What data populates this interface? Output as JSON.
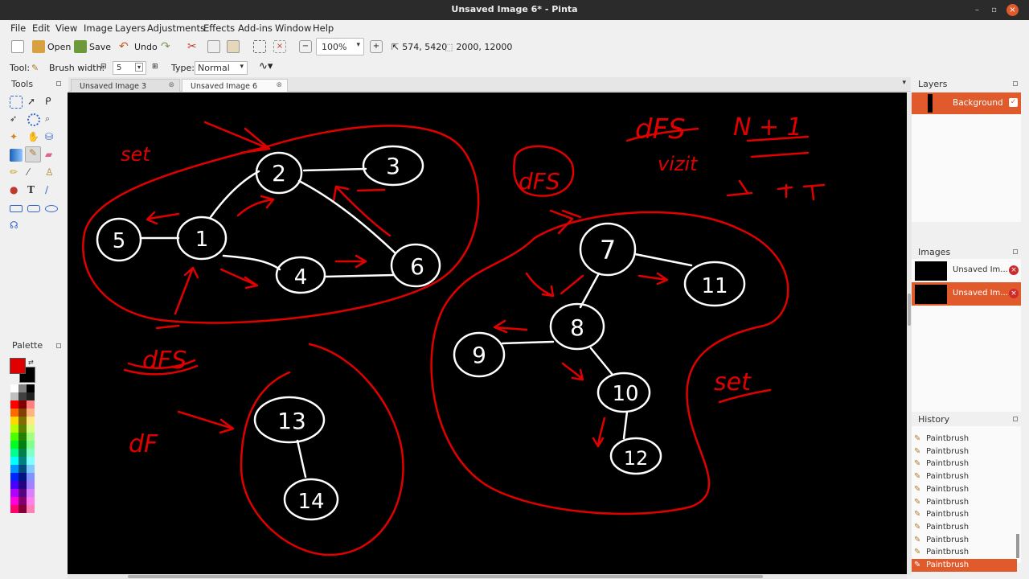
{
  "window": {
    "title": "Unsaved Image 6* - Pinta"
  },
  "menu": [
    "File",
    "Edit",
    "View",
    "Image",
    "Layers",
    "Adjustments",
    "Effects",
    "Add-ins",
    "Window",
    "Help"
  ],
  "toolbar": {
    "open_label": "Open",
    "save_label": "Save",
    "undo_label": "Undo",
    "zoom_value": "100%",
    "cursor_position": "574, 5420",
    "selection_size": "2000, 12000"
  },
  "tool_options": {
    "tool_label": "Tool:",
    "brush_width_label": "Brush width:",
    "brush_width_value": "5",
    "type_label": "Type:",
    "type_value": "Normal"
  },
  "panels": {
    "tools_title": "Tools",
    "palette_title": "Palette",
    "layers_title": "Layers",
    "images_title": "Images",
    "history_title": "History"
  },
  "tabs": [
    {
      "label": "Unsaved Image 3",
      "active": false
    },
    {
      "label": "Unsaved Image 6",
      "active": true
    }
  ],
  "layers": [
    {
      "name": "Background",
      "visible": true
    }
  ],
  "images": [
    {
      "name": "Unsaved Im...",
      "selected": false
    },
    {
      "name": "Unsaved Im...",
      "selected": true
    }
  ],
  "history": [
    "Paintbrush",
    "Paintbrush",
    "Paintbrush",
    "Paintbrush",
    "Paintbrush",
    "Paintbrush",
    "Paintbrush",
    "Paintbrush",
    "Paintbrush",
    "Paintbrush",
    "Paintbrush"
  ],
  "colors": {
    "accent": "#e05a2c",
    "primary_color": "#e00000",
    "secondary_color": "#000000",
    "canvas": "#000000",
    "ink_red": "#e00000",
    "ink_white": "#ffffff"
  },
  "drawing": {
    "nodes": [
      "1",
      "2",
      "3",
      "4",
      "5",
      "6",
      "7",
      "8",
      "9",
      "10",
      "11",
      "12",
      "13",
      "14"
    ],
    "annotations": [
      "set",
      "dFS",
      "dFS",
      "dFS",
      "N + 1",
      "vizit",
      "dF",
      "set"
    ]
  }
}
